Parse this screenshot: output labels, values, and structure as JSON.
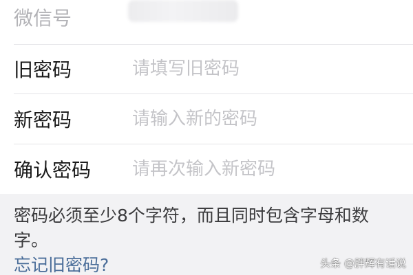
{
  "form": {
    "wechat_id": {
      "label": "微信号"
    },
    "old_password": {
      "label": "旧密码",
      "placeholder": "请填写旧密码"
    },
    "new_password": {
      "label": "新密码",
      "placeholder": "请输入新的密码"
    },
    "confirm_password": {
      "label": "确认密码",
      "placeholder": "请再次输入新密码"
    }
  },
  "hint": "密码必须至少8个字符，而且同时包含字母和数字。",
  "forgot_link": "忘记旧密码?",
  "watermark": "头条 @胖辉有话说",
  "colors": {
    "background": "#f2f2f4",
    "link": "#4a6d99",
    "placeholder": "#c4c4c8"
  }
}
